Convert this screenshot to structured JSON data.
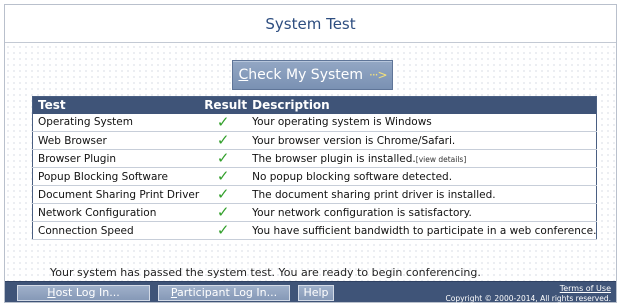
{
  "header": {
    "title": "System Test"
  },
  "check_button": {
    "label_underlined": "C",
    "label_rest": "heck My System",
    "arrow": "···>"
  },
  "table": {
    "columns": [
      "Test",
      "Result",
      "Description"
    ],
    "rows": [
      {
        "test": "Operating System",
        "result": "✓",
        "description": "Your operating system is Windows"
      },
      {
        "test": "Web Browser",
        "result": "✓",
        "description": "Your browser version is Chrome/Safari."
      },
      {
        "test": "Browser Plugin",
        "result": "✓",
        "description": "The browser plugin is installed.",
        "link": "[view details]"
      },
      {
        "test": "Popup Blocking Software",
        "result": "✓",
        "description": "No popup blocking software detected."
      },
      {
        "test": "Document Sharing Print Driver",
        "result": "✓",
        "description": "The document sharing print driver is installed."
      },
      {
        "test": "Network Configuration",
        "result": "✓",
        "description": "Your network configuration is satisfactory."
      },
      {
        "test": "Connection Speed",
        "result": "✓",
        "description": "You have sufficient bandwidth to participate in a web conference."
      }
    ]
  },
  "status_message": "Your system has passed the system test. You are ready to begin conferencing.",
  "footer": {
    "host_login": {
      "u": "H",
      "rest": "ost Log In..."
    },
    "participant_login": {
      "u": "P",
      "rest": "articipant Log In..."
    },
    "help": "Help",
    "terms_link": "Terms of Use",
    "copyright": "Copyright © 2000-2014, All rights reserved."
  },
  "colors": {
    "header_text": "#2e4e80",
    "table_header": "#3f5478",
    "check": "#33a02c",
    "footer_bg": "#3f5478"
  }
}
